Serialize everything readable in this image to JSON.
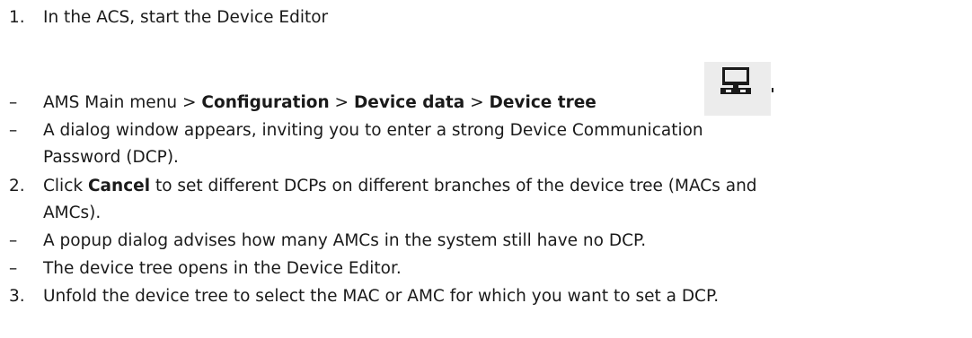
{
  "steps": [
    {
      "marker": "1.",
      "text": "In the ACS, start the Device Editor"
    },
    {
      "marker": "–",
      "parts": [
        "AMS Main menu > ",
        "Configuration",
        " > ",
        "Device data",
        " > ",
        "Device tree"
      ]
    },
    {
      "marker": "–",
      "lines": [
        "A dialog window appears, inviting you to enter a strong Device Communication",
        "Password (DCP)."
      ]
    },
    {
      "marker": "2.",
      "parts": [
        "Click ",
        "Cancel",
        " to set different DCPs on different branches of the device tree (MACs and"
      ],
      "cont": "AMCs)."
    },
    {
      "marker": "–",
      "text": "A popup dialog advises how many AMCs in the system still have no DCP."
    },
    {
      "marker": "–",
      "text": "The device tree opens in the Device Editor."
    },
    {
      "marker": "3.",
      "text": "Unfold the device tree to select the MAC or AMC for which you want to set a DCP."
    }
  ],
  "icon": "device-tree-icon",
  "colors": {
    "text": "#1a1a1a",
    "icon_bg": "#ececec"
  }
}
